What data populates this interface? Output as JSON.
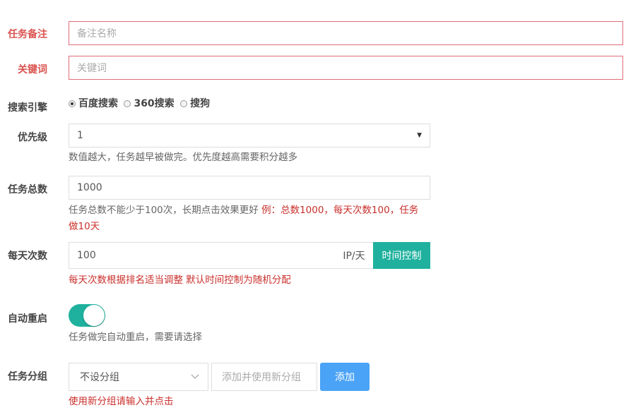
{
  "form": {
    "remark": {
      "label": "任务备注",
      "placeholder": "备注名称"
    },
    "keyword": {
      "label": "关键词",
      "placeholder": "关键词"
    },
    "engine": {
      "label": "搜索引擎",
      "options": [
        "百度搜索",
        "360搜索",
        "搜狗"
      ],
      "selected": "百度搜索"
    },
    "priority": {
      "label": "优先级",
      "value": "1",
      "help": "数值越大，任务越早被做完。优先度越高需要积分越多"
    },
    "total": {
      "label": "任务总数",
      "value": "1000",
      "help_line1": "任务总数不能少于100次，长期点击效果更好",
      "help_example1": "例：总数1000，每天次数100，任务",
      "help_example2": "做10天"
    },
    "daily": {
      "label": "每天次数",
      "value": "100",
      "unit": "IP/天",
      "time_button": "时间控制",
      "help": "每天次数根据排名适当调整 默认时间控制为随机分配"
    },
    "restart": {
      "label": "自动重启",
      "enabled": true,
      "help": "任务做完自动重启，需要请选择"
    },
    "group": {
      "label": "任务分组",
      "selected": "不设分组",
      "new_placeholder": "添加并使用新分组",
      "add_button": "添加",
      "help": "使用新分组请输入并点击"
    }
  },
  "colors": {
    "required": "#d9534f",
    "accent": "#1fb19e",
    "primary_button": "#4aa3f6",
    "warning_text": "#c9302c"
  }
}
